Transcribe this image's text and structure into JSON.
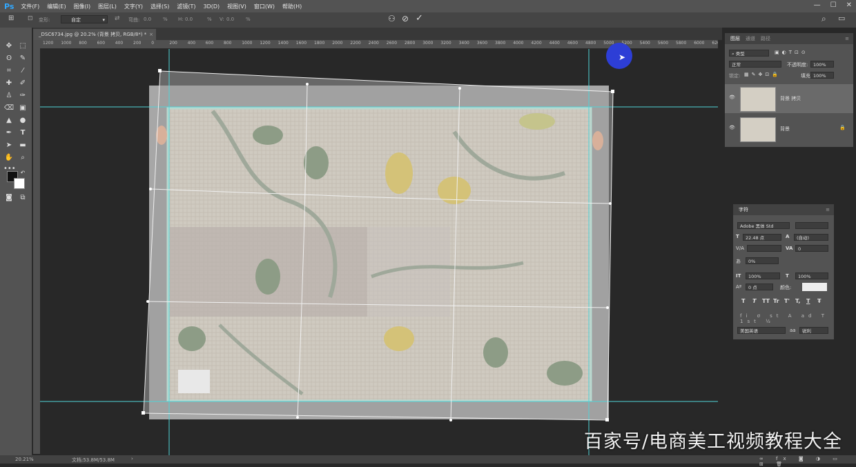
{
  "app": {
    "logo": "Ps"
  },
  "menu": [
    "文件(F)",
    "编辑(E)",
    "图像(I)",
    "图层(L)",
    "文字(Y)",
    "选择(S)",
    "滤镜(T)",
    "3D(D)",
    "视图(V)",
    "窗口(W)",
    "帮助(H)"
  ],
  "options": {
    "transform_label": "变形:",
    "transform_mode": "自定",
    "curve_label": "弯曲:",
    "curve_value": "0.0",
    "h_label": "H:",
    "h_value": "0.0",
    "v_label": "V:",
    "v_value": "0.0",
    "percent": "%"
  },
  "document": {
    "tab_title": "_DSC6734.jpg @ 20.2% (背景 拷贝, RGB/8*) *",
    "close": "×"
  },
  "ruler": {
    "ticks": [
      "1200",
      "1000",
      "800",
      "600",
      "400",
      "200",
      "0",
      "200",
      "400",
      "600",
      "800",
      "1000",
      "1200",
      "1400",
      "1600",
      "1800",
      "2000",
      "2200",
      "2400",
      "2600",
      "2800",
      "3000",
      "3200",
      "3400",
      "3600",
      "3800",
      "4000",
      "4200",
      "4400",
      "4600",
      "4800",
      "5000",
      "5200",
      "5400",
      "5600",
      "5800",
      "6000",
      "620"
    ]
  },
  "layers_panel": {
    "tabs": [
      "图层",
      "通道",
      "路径"
    ],
    "filter_placeholder": "类型",
    "blend_mode": "正常",
    "opacity_label": "不透明度:",
    "opacity_value": "100%",
    "lock_label": "锁定:",
    "fill_label": "填充:",
    "fill_value": "100%",
    "layers": [
      {
        "name": "背景 拷贝",
        "selected": true
      },
      {
        "name": "背景",
        "locked": true
      }
    ]
  },
  "character_panel": {
    "title": "字符",
    "font_family": "Adobe 黑体 Std",
    "font_size": "22.48 点",
    "leading": "(自动)",
    "kerning_label": "V/A",
    "tracking_value": "0",
    "scale_tsume": "0%",
    "vertical_scale": "100%",
    "horizontal_scale": "100%",
    "baseline_shift": "0 点",
    "color_label": "颜色:",
    "style_buttons": [
      "T",
      "T",
      "TT",
      "Tr",
      "T'",
      "T,",
      "T",
      "Ŧ"
    ],
    "language": "美国英语",
    "antialias_label": "aa",
    "antialias": "锐利"
  },
  "status": {
    "zoom": "20.21%",
    "doc_size": "文档:53.8M/53.8M",
    "arrow": "›"
  },
  "watermark": "百家号/电商美工视频教程大全",
  "colors": {
    "accent": "#31a8ff",
    "guide": "#4fd3d8",
    "cursor_highlight": "#2d3ed6"
  }
}
